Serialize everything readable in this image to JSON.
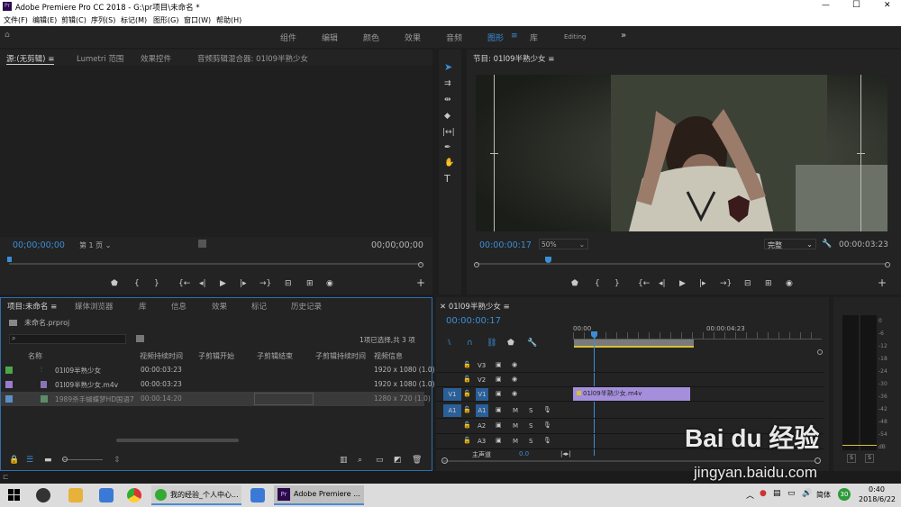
{
  "window": {
    "title": "Adobe Premiere Pro CC 2018 - G:\\pr项目\\未命名 *",
    "icon": "Pr",
    "min": "—",
    "max": "☐",
    "close": "✕"
  },
  "menu": [
    "文件(F)",
    "编辑(E)",
    "剪辑(C)",
    "序列(S)",
    "标记(M)",
    "图形(G)",
    "窗口(W)",
    "帮助(H)"
  ],
  "workspaces": [
    "组件",
    "编辑",
    "颜色",
    "效果",
    "音频",
    "图形",
    "库",
    "Editing"
  ],
  "workspace_active": "图形",
  "workspace_more": "»",
  "source": {
    "tabs": [
      "源:(无剪辑)",
      "Lumetri 范围",
      "效果控件",
      "音频剪辑混合器: 01l09半熟少女"
    ],
    "timecode": "00;00;00;00",
    "page": "第 1 页",
    "duration": "00;00;00;00"
  },
  "tools": [
    "selection-tool",
    "track-select-tool",
    "ripple-edit-tool",
    "razor-tool",
    "slip-tool",
    "pen-tool",
    "hand-tool",
    "type-tool"
  ],
  "program": {
    "tab": "节目: 01l09半熟少女",
    "timecode": "00:00:00:17",
    "zoom": "50%",
    "quality": "完整",
    "duration": "00:00:03:23"
  },
  "project": {
    "tabs": [
      "项目:未命名",
      "媒体浏览器",
      "库",
      "信息",
      "效果",
      "标记",
      "历史记录"
    ],
    "file": "未命名.prproj",
    "selection": "1项已选择,共 3 项",
    "columns": [
      "名称",
      "视频持续时间",
      "子剪辑开始",
      "子剪辑结束",
      "子剪辑持续时间",
      "视频信息"
    ],
    "rows": [
      {
        "color": "#4aa84a",
        "icon": "sequence-icon",
        "name": "01l09半熟少女",
        "dur": "00:00:03:23",
        "info": "1920 x 1080 (1.0)"
      },
      {
        "color": "#9a7bd0",
        "icon": "video-clip-icon",
        "name": "01l09半熟少女.m4v",
        "dur": "00:00:03:23",
        "info": "1920 x 1080 (1.0)"
      },
      {
        "color": "#5a8fc8",
        "icon": "still-image-icon",
        "name": "1989杀手蝴蝶梦HD国语7",
        "dur": "00:00:14:20",
        "info": "1280 x 720 (1.0)"
      }
    ]
  },
  "timeline": {
    "tab": "01l09半熟少女",
    "timecode": "00:00:00:17",
    "ruler": [
      "00:00",
      "00:00:04:23"
    ],
    "tracks": [
      {
        "name": "V3",
        "sel": ""
      },
      {
        "name": "V2",
        "sel": ""
      },
      {
        "name": "V1",
        "sel": "V1"
      },
      {
        "name": "A1",
        "sel": "A1"
      },
      {
        "name": "A2",
        "sel": ""
      },
      {
        "name": "A3",
        "sel": ""
      }
    ],
    "clip": "01l09半熟少女.m4v",
    "master": "主声道",
    "master_val": "0.0"
  },
  "meter": {
    "labels": [
      "0",
      "-6",
      "-12",
      "-18",
      "-24",
      "-30",
      "-36",
      "-42",
      "-48",
      "-54",
      "dB"
    ],
    "buttons": [
      "S",
      "S"
    ]
  },
  "taskbar": {
    "apps": [
      "我的经验_个人中心...",
      "Adobe Premiere ..."
    ],
    "lang": "简体",
    "time": "0:40",
    "date": "2018/6/22",
    "badge": "30"
  },
  "watermark": {
    "brand": "Bai du 经验",
    "url": "jingyan.baidu.com"
  }
}
